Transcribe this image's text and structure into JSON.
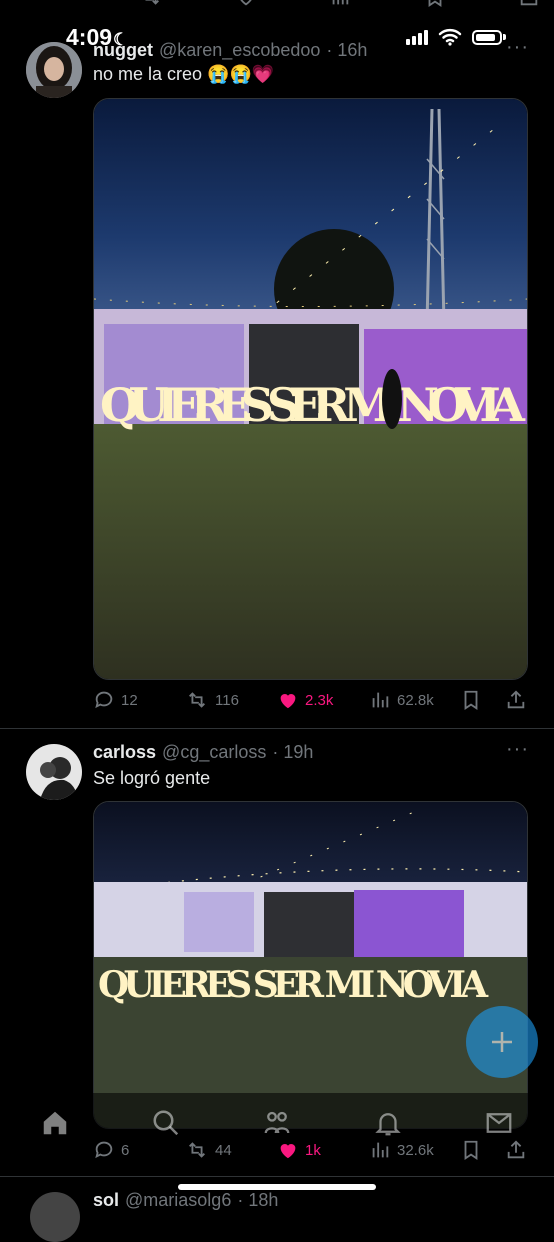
{
  "status_bar": {
    "time": "4:09",
    "moon": "☾"
  },
  "top_actions": [
    "",
    "",
    "",
    "",
    "",
    ""
  ],
  "tweets": [
    {
      "name": "nugget",
      "handle": "@karen_escobedoo",
      "time": "· 16h",
      "text": "no me la creo 😭😭💗",
      "image_sign": "QUIERES SER MI NOVIA",
      "replies": "12",
      "retweets": "116",
      "likes": "2.3k",
      "views": "62.8k"
    },
    {
      "name": "carloss",
      "handle": "@cg_carloss",
      "time": "· 19h",
      "text": "Se logró gente",
      "image_sign": "QUIERES SER MI NOVIA",
      "replies": "6",
      "retweets": "44",
      "likes": "1k",
      "views": "32.6k"
    }
  ],
  "partial_tweet": {
    "name": "sol",
    "handle": "@mariasolg6",
    "time": "· 18h"
  },
  "colors": {
    "accent": "#1d9bf0",
    "like": "#f91880",
    "muted": "#71767b",
    "text": "#e7e9ea"
  }
}
